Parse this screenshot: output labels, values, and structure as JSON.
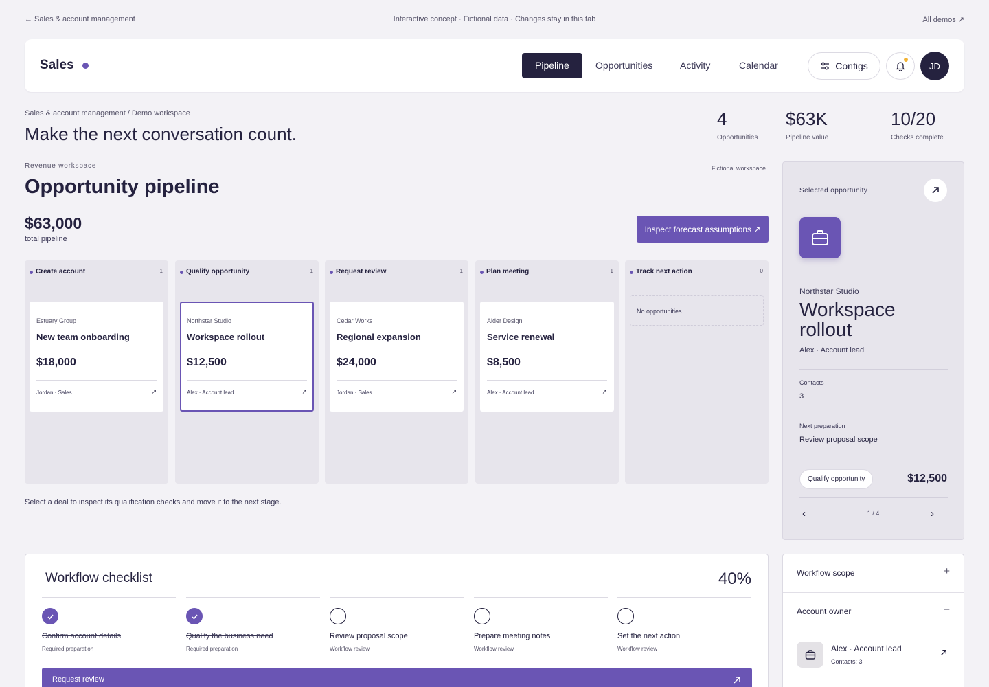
{
  "topbar": {
    "back": "← Sales & account management",
    "notice": "Interactive concept · Fictional data · Changes stay in this tab",
    "demos": "All demos ↗"
  },
  "header": {
    "brand": "Sales",
    "tabs": [
      "Pipeline",
      "Opportunities",
      "Activity",
      "Calendar"
    ],
    "active_tab": "Pipeline",
    "configs": "Configs",
    "avatar": "JD"
  },
  "intro": {
    "breadcrumb": "Sales & account management / Demo workspace",
    "title": "Make the next conversation count."
  },
  "stats": [
    {
      "value": "4",
      "label": "Opportunities"
    },
    {
      "value": "$63K",
      "label": "Pipeline value"
    },
    {
      "value": "10/20",
      "label": "Checks complete"
    }
  ],
  "pipeline": {
    "eyebrow": "Revenue workspace",
    "fictional": "Fictional workspace",
    "title": "Opportunity pipeline",
    "total_value": "$63,000",
    "total_label": "total pipeline",
    "inspect": "Inspect forecast assumptions ↗",
    "hint": "Select a deal to inspect its qualification checks and move it to the next stage.",
    "columns": [
      {
        "name": "Create account",
        "count": "1",
        "card": {
          "company": "Estuary Group",
          "title": "New team onboarding",
          "value": "$18,000",
          "owner": "Jordan · Sales",
          "arrow": "↗"
        }
      },
      {
        "name": "Qualify opportunity",
        "count": "1",
        "card": {
          "company": "Northstar Studio",
          "title": "Workspace rollout",
          "value": "$12,500",
          "owner": "Alex · Account lead",
          "arrow": "↗"
        }
      },
      {
        "name": "Request review",
        "count": "1",
        "card": {
          "company": "Cedar Works",
          "title": "Regional expansion",
          "value": "$24,000",
          "owner": "Jordan · Sales",
          "arrow": "↗"
        }
      },
      {
        "name": "Plan meeting",
        "count": "1",
        "card": {
          "company": "Alder Design",
          "title": "Service renewal",
          "value": "$8,500",
          "owner": "Alex · Account lead",
          "arrow": "↗"
        }
      },
      {
        "name": "Track next action",
        "count": "0",
        "empty": "No opportunities"
      }
    ]
  },
  "selected": {
    "label": "Selected opportunity",
    "company": "Northstar Studio",
    "title": "Workspace rollout",
    "owner": "Alex · Account lead",
    "contacts_label": "Contacts",
    "contacts": "3",
    "next_label": "Next preparation",
    "next": "Review proposal scope",
    "stage": "Qualify opportunity",
    "amount": "$12,500",
    "pager": "1 / 4",
    "prev": "‹",
    "next_arrow": "›"
  },
  "checklist": {
    "title": "Workflow checklist",
    "percent": "40%",
    "progress": 40,
    "steps": [
      {
        "name": "Confirm account details",
        "meta": "Required preparation",
        "done": true
      },
      {
        "name": "Qualify the business need",
        "meta": "Required preparation",
        "done": true
      },
      {
        "name": "Review proposal scope",
        "meta": "Workflow review",
        "done": false
      },
      {
        "name": "Prepare meeting notes",
        "meta": "Workflow review",
        "done": false
      },
      {
        "name": "Set the next action",
        "meta": "Workflow review",
        "done": false
      }
    ],
    "action": "Request review"
  },
  "accordion": {
    "scope": "Workflow scope",
    "scope_symbol": "+",
    "owner": "Account owner",
    "owner_symbol": "−",
    "owner_name": "Alex · Account lead",
    "owner_contacts": "Contacts: 3"
  },
  "colors": {
    "accent": "#6a55b4",
    "ink": "#25223f",
    "notify": "#f2b233"
  }
}
